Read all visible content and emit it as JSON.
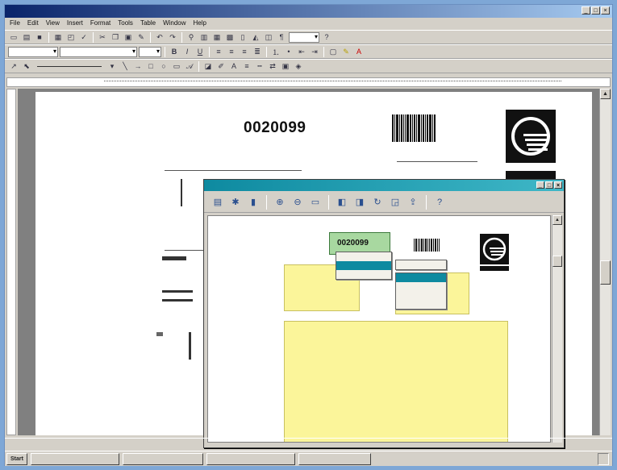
{
  "window": {
    "title": "",
    "controls": [
      "_",
      "□",
      "×"
    ]
  },
  "menubar": {
    "items": [
      "File",
      "Edit",
      "View",
      "Insert",
      "Format",
      "Tools",
      "Table",
      "Window",
      "Help"
    ]
  },
  "toolbar_fmt": {
    "style": "",
    "font": "",
    "size": "",
    "zoom": ""
  },
  "document": {
    "number": "0020099",
    "colors": {
      "page": "#ffffff",
      "workspace": "#808080"
    }
  },
  "viewer": {
    "title": "",
    "doc_number": "0020099",
    "context_menu_1": {
      "items": [
        "",
        "",
        ""
      ]
    },
    "context_menu_2": {
      "items": [
        ""
      ]
    },
    "context_menu_3": {
      "items": [
        "",
        "",
        "",
        ""
      ]
    },
    "footer_left": "",
    "footer_right": "",
    "colors": {
      "highlight": "#a8d8a0",
      "field": "#fbf59a",
      "title": "#0e8aa0"
    }
  },
  "taskbar": {
    "start": "Start",
    "tasks": [
      "",
      "",
      "",
      ""
    ],
    "tray": ""
  }
}
